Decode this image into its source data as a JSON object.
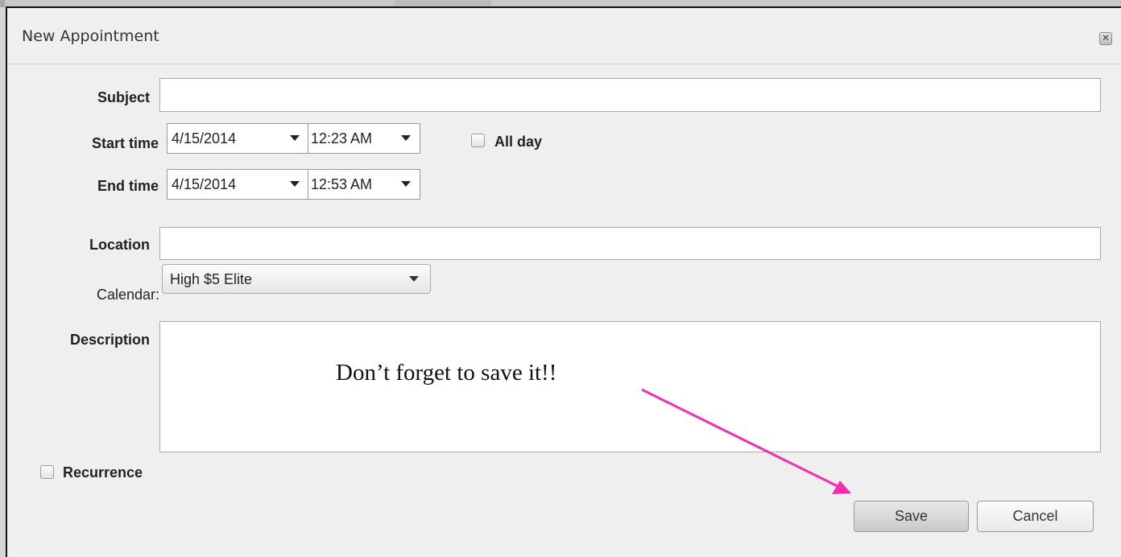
{
  "dialog": {
    "title": "New Appointment",
    "close_icon": "close-icon",
    "close_glyph": "✕"
  },
  "form": {
    "subject_label": "Subject",
    "subject_value": "",
    "start_label": "Start time",
    "start_date": "4/15/2014",
    "start_time": "12:23 AM",
    "allday_label": "All day",
    "allday_checked": false,
    "end_label": "End time",
    "end_date": "4/15/2014",
    "end_time": "12:53 AM",
    "location_label": "Location",
    "location_value": "",
    "calendar_label": "Calendar:",
    "calendar_value": "High $5 Elite",
    "description_label": "Description",
    "description_value": "",
    "recurrence_label": "Recurrence",
    "recurrence_checked": false
  },
  "annotation": {
    "text": "Don’t forget to save it!!",
    "arrow_color": "#f030b0"
  },
  "buttons": {
    "save_label": "Save",
    "cancel_label": "Cancel"
  }
}
